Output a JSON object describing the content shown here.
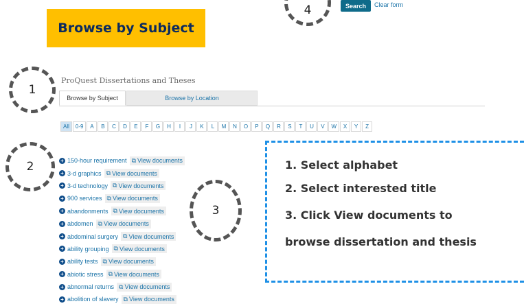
{
  "search": {
    "button_label": "Search",
    "clear_label": "Clear form"
  },
  "banner": {
    "title": "Browse by Subject"
  },
  "header": {
    "title": "ProQuest Dissertations and Theses"
  },
  "tabs": [
    {
      "label": "Browse by Subject",
      "active": true
    },
    {
      "label": "Browse by Location",
      "active": false
    }
  ],
  "alphabet": [
    "All",
    "0-9",
    "A",
    "B",
    "C",
    "D",
    "E",
    "F",
    "G",
    "H",
    "I",
    "J",
    "K",
    "L",
    "M",
    "N",
    "O",
    "P",
    "Q",
    "R",
    "S",
    "T",
    "U",
    "V",
    "W",
    "X",
    "Y",
    "Z"
  ],
  "alphabet_selected": "All",
  "subjects": [
    {
      "name": "150-hour requirement",
      "action": "View documents"
    },
    {
      "name": "3-d graphics",
      "action": "View documents"
    },
    {
      "name": "3-d technology",
      "action": "View documents"
    },
    {
      "name": "900 services",
      "action": "View documents"
    },
    {
      "name": "abandonments",
      "action": "View documents"
    },
    {
      "name": "abdomen",
      "action": "View documents"
    },
    {
      "name": "abdominal surgery",
      "action": "View documents"
    },
    {
      "name": "ability grouping",
      "action": "View documents"
    },
    {
      "name": "ability tests",
      "action": "View documents"
    },
    {
      "name": "abiotic stress",
      "action": "View documents"
    },
    {
      "name": "abnormal returns",
      "action": "View documents"
    },
    {
      "name": "abolition of slavery",
      "action": "View documents"
    }
  ],
  "steps": {
    "s1": "1",
    "s2": "2",
    "s3": "3",
    "s4": "4"
  },
  "instructions": {
    "line1": "1. Select alphabet",
    "line2": "2. Select interested title",
    "line3": "3. Click View documents to",
    "line4": "browse dissertation and thesis"
  },
  "colors": {
    "banner": "#ffbf00",
    "search_button": "#0f6b8a",
    "instruction_border": "#1e90e6",
    "link": "#1a73a8"
  }
}
